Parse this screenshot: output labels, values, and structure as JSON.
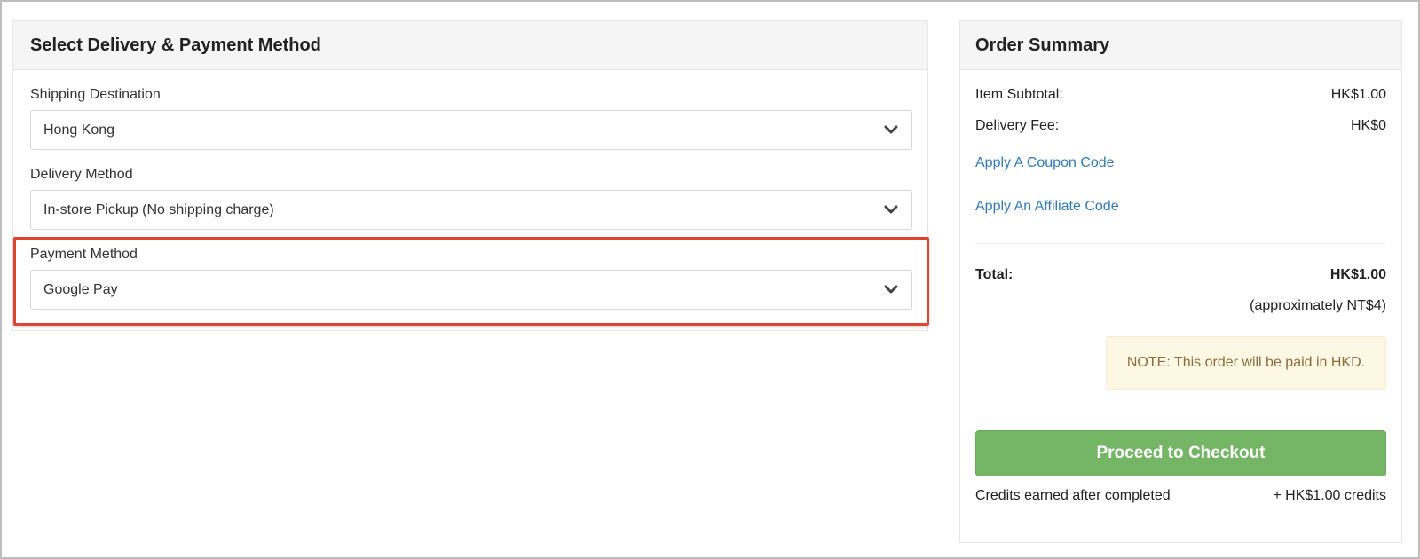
{
  "left_panel": {
    "title": "Select Delivery & Payment Method",
    "shipping": {
      "label": "Shipping Destination",
      "value": "Hong Kong"
    },
    "delivery": {
      "label": "Delivery Method",
      "value": "In-store Pickup (No shipping charge)"
    },
    "payment": {
      "label": "Payment Method",
      "value": "Google Pay"
    }
  },
  "summary": {
    "title": "Order Summary",
    "item_subtotal_label": "Item Subtotal:",
    "item_subtotal_value": "HK$1.00",
    "delivery_fee_label": "Delivery Fee:",
    "delivery_fee_value": "HK$0",
    "coupon_link": "Apply A Coupon Code",
    "affiliate_link": "Apply An Affiliate Code",
    "total_label": "Total:",
    "total_value": "HK$1.00",
    "approx": "(approximately NT$4)",
    "note": "NOTE: This order will be paid in HKD.",
    "checkout_label": "Proceed to Checkout",
    "credits_label": "Credits earned after completed",
    "credits_value": "+ HK$1.00 credits"
  },
  "colors": {
    "highlight": "#e0432f",
    "link": "#337ab7",
    "checkout": "#74b566",
    "note_bg": "#fcf8e3",
    "note_text": "#8a6d3b"
  },
  "icons": [
    "chevron-down-icon"
  ]
}
